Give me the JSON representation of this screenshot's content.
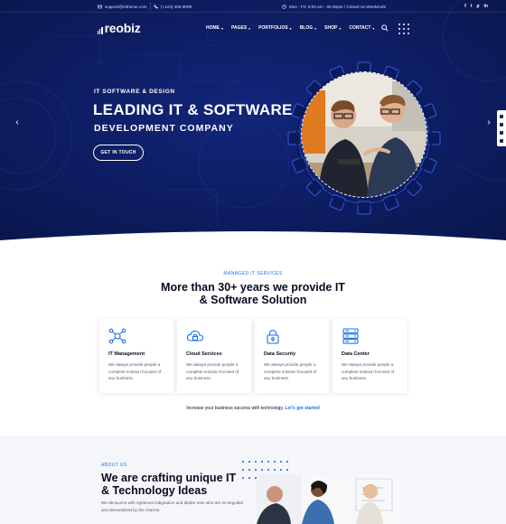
{
  "topbar": {
    "email": "support@rstheme.com",
    "phone": "(+123) 456-9009",
    "hours": "Mon - Fri: 9:00 am - 06.00pm / Closed on Weekends",
    "social": [
      "f",
      "t",
      "p",
      "in"
    ]
  },
  "header": {
    "logo": "reobiz",
    "menu": [
      {
        "label": "HOME"
      },
      {
        "label": "PAGES"
      },
      {
        "label": "PORTFOLIOS"
      },
      {
        "label": "BLOG"
      },
      {
        "label": "SHOP"
      },
      {
        "label": "CONTACT"
      }
    ]
  },
  "hero": {
    "subtitle": "IT SOFTWARE & DESIGN",
    "title_line1": "LEADING IT & SOFTWARE",
    "title_line2": "DEVELOPMENT COMPANY",
    "cta": "GET IN TOUCH",
    "prev_arrow": "‹",
    "next_arrow": "›"
  },
  "services": {
    "kicker": "MANAGED IT SERVICES",
    "title_line1": "More than 30+ years we provide IT",
    "title_line2": "& Software Solution",
    "cards": [
      {
        "title": "IT Management",
        "icon": "network-icon",
        "text": "We always provide people a complete solution focused of any business."
      },
      {
        "title": "Cloud Services",
        "icon": "cloud-lock-icon",
        "text": "We always provide people a complete solution focused of any business."
      },
      {
        "title": "Data Security",
        "icon": "padlock-icon",
        "text": "We always provide people a complete solution focused of any business."
      },
      {
        "title": "Data Center",
        "icon": "server-icon",
        "text": "We always provide people a complete solution focused of any business."
      }
    ],
    "cta_text": "Increase your business success with technology.",
    "cta_link": "Let's get started"
  },
  "about": {
    "kicker": "ABOUT US",
    "title_line1": "We are crafting unique IT",
    "title_line2": "& Technology Ideas",
    "text": "We denounce with righteous indignation and dislike men who are so beguiled and demoralized by the charms."
  },
  "colors": {
    "hero_bg": "#0b1a5c",
    "accent": "#1a73e8",
    "heading": "#0a0a23"
  }
}
